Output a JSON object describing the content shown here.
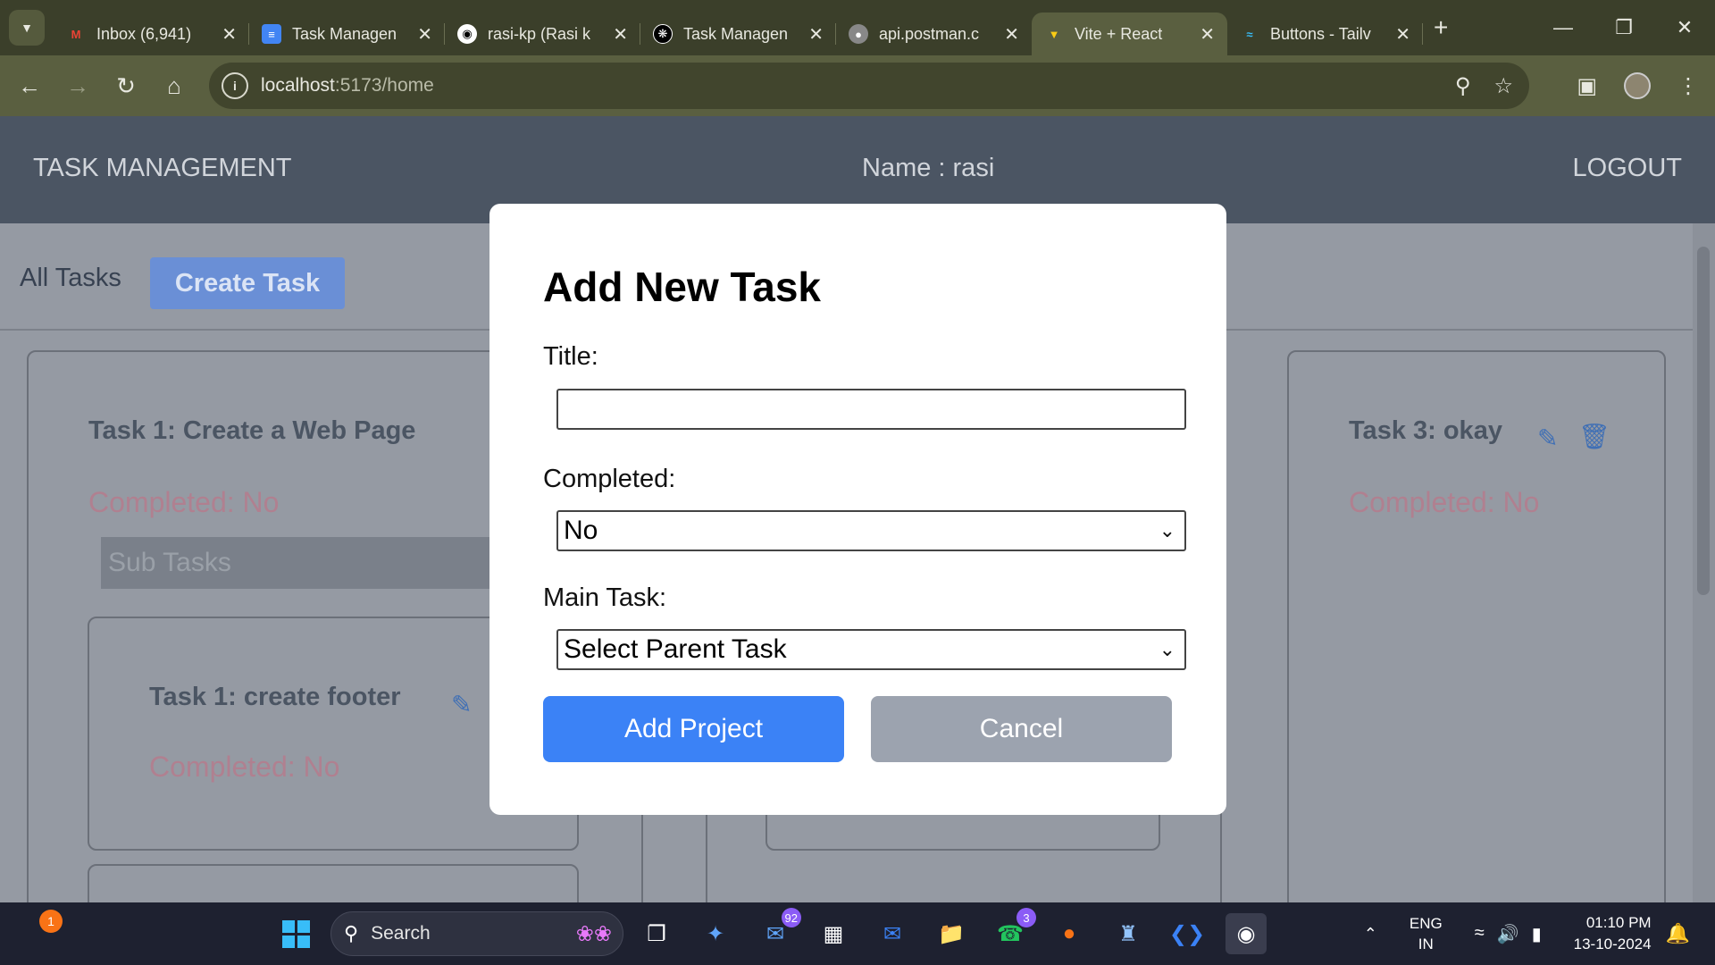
{
  "browser": {
    "tabs": [
      {
        "title": "Inbox (6,941)",
        "icon": "gmail-icon",
        "color": "#ea4335"
      },
      {
        "title": "Task Managen",
        "icon": "docs-icon",
        "color": "#4285f4"
      },
      {
        "title": "rasi-kp (Rasi k",
        "icon": "github-icon",
        "color": "#ffffff"
      },
      {
        "title": "Task Managen",
        "icon": "chatgpt-icon",
        "color": "#ffffff"
      },
      {
        "title": "api.postman.c",
        "icon": "globe-icon",
        "color": "#cccccc"
      },
      {
        "title": "Vite + React",
        "icon": "vite-icon",
        "color": "#a855f7",
        "active": true
      },
      {
        "title": "Buttons - Tailv",
        "icon": "tailwind-icon",
        "color": "#38bdf8"
      }
    ],
    "url_host": "localhost",
    "url_path": ":5173/home"
  },
  "app": {
    "brand": "TASK MANAGEMENT",
    "user_name": "Name : rasi",
    "logout": "LOGOUT",
    "all_tasks": "All Tasks",
    "create_task": "Create Task",
    "cards": [
      {
        "title": "Task 1: Create a Web Page",
        "status": "Completed: No",
        "subtasks_label": "Sub Tasks"
      },
      {
        "title": "Task 1: create footer",
        "status": "Completed: No"
      },
      {
        "title": "Task 3: okay",
        "status": "Completed: No"
      }
    ]
  },
  "modal": {
    "title": "Add New Task",
    "title_label": "Title:",
    "title_value": "",
    "completed_label": "Completed:",
    "completed_value": "No",
    "main_task_label": "Main Task:",
    "main_task_value": "Select Parent Task",
    "add_button": "Add Project",
    "cancel_button": "Cancel"
  },
  "taskbar": {
    "search": "Search",
    "notification_count": "1",
    "outlook_badge": "92",
    "whatsapp_badge": "3",
    "lang_line1": "ENG",
    "lang_line2": "IN",
    "time": "01:10 PM",
    "date": "13-10-2024"
  },
  "colors": {
    "primary_button": "#3b82f6",
    "cancel_button": "#9ca3af",
    "status_text": "#b08090",
    "header_bg": "#4b5563"
  }
}
